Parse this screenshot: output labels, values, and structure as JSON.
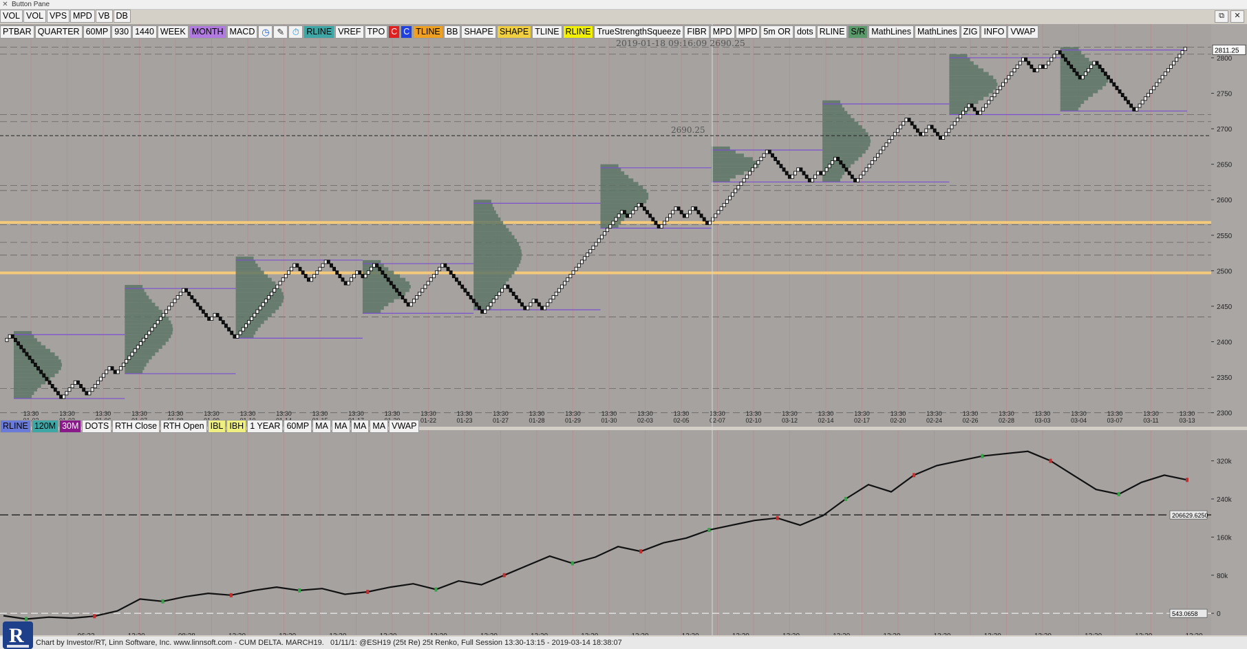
{
  "window": {
    "title": "Button Pane"
  },
  "toolbar1": [
    {
      "label": "VOL"
    },
    {
      "label": "VOL"
    },
    {
      "label": "VPS"
    },
    {
      "label": "MPD"
    },
    {
      "label": "VB"
    },
    {
      "label": "DB"
    }
  ],
  "toolbar2": [
    {
      "label": "PTBAR"
    },
    {
      "label": "QUARTER"
    },
    {
      "label": "60MP"
    },
    {
      "label": "930"
    },
    {
      "label": "1440"
    },
    {
      "label": "WEEK"
    },
    {
      "label": "MONTH",
      "bg": "#b07ae0"
    },
    {
      "label": "MACD"
    },
    {
      "icon": "clock-icon",
      "glyph": "◷",
      "fg": "#1a5fd0"
    },
    {
      "icon": "pencil-icon",
      "glyph": "✎",
      "fg": "#333"
    },
    {
      "icon": "stopwatch-icon",
      "glyph": "⏱",
      "fg": "#1a8fd0"
    },
    {
      "label": "RLINE",
      "bg": "#3fa6a6"
    },
    {
      "label": "VREF"
    },
    {
      "label": "TPO"
    },
    {
      "label": "C",
      "bg": "#e02020",
      "fg": "#ffffff"
    },
    {
      "label": "C",
      "bg": "#2040e0",
      "fg": "#ffffff"
    },
    {
      "label": "TLINE",
      "bg": "#f0a020"
    },
    {
      "label": "BB"
    },
    {
      "label": "SHAPE"
    },
    {
      "label": "SHAPE",
      "bg": "#f0d040"
    },
    {
      "label": "TLINE"
    },
    {
      "label": "RLINE",
      "bg": "#f0f000"
    },
    {
      "label": "TrueStrengthSqueeze"
    },
    {
      "label": "FIBR"
    },
    {
      "label": "MPD"
    },
    {
      "label": "MPD"
    },
    {
      "label": "5m OR"
    },
    {
      "label": "dots"
    },
    {
      "label": "RLINE"
    },
    {
      "label": "S/R",
      "bg": "#5a9a6a"
    },
    {
      "label": "MathLines"
    },
    {
      "label": "MathLines"
    },
    {
      "label": "ZIG"
    },
    {
      "label": "INFO"
    },
    {
      "label": "VWAP"
    }
  ],
  "toolbar3": [
    {
      "label": "RLINE",
      "bg": "#6a7ad8"
    },
    {
      "label": "120M",
      "bg": "#3fa6a6"
    },
    {
      "label": "30M",
      "bg": "#8a1a8a",
      "fg": "#ffffff"
    },
    {
      "label": "DOTS"
    },
    {
      "label": "RTH Close"
    },
    {
      "label": "RTH Open"
    },
    {
      "label": "IBL",
      "bg": "#f0f080"
    },
    {
      "label": "IBH",
      "bg": "#f0f080"
    },
    {
      "label": "1 YEAR"
    },
    {
      "label": "60MP"
    },
    {
      "label": "MA"
    },
    {
      "label": "MA"
    },
    {
      "label": "MA"
    },
    {
      "label": "MA"
    },
    {
      "label": "VWAP"
    }
  ],
  "window_controls": [
    {
      "icon": "restore-icon",
      "glyph": "⧉"
    },
    {
      "icon": "close-icon",
      "glyph": "✕"
    }
  ],
  "colors": {
    "chart_bg": "#a5a2a0",
    "right_axis_bg": "#a9a6a4",
    "profile": "#5c7565",
    "gold": "#f5c97a",
    "purple": "#7a4fd0",
    "grid": "#c07c86",
    "crosshair": "#d8d8d8"
  },
  "chart_data": [
    {
      "type": "renko",
      "panel": "price",
      "ylim": [
        2290,
        2830
      ],
      "yticks": [
        2300,
        2350,
        2400,
        2450,
        2500,
        2550,
        2600,
        2650,
        2700,
        2750,
        2800
      ],
      "last_price_label": "2811.25",
      "crosshair_readout": "2019-01-18 09:16:09 2690.25",
      "crosshair_price_label": "2690.25",
      "path": [
        2400,
        2410,
        2365,
        2320,
        2345,
        2325,
        2365,
        2355,
        2390,
        2430,
        2475,
        2440,
        2430,
        2440,
        2405,
        2455,
        2495,
        2510,
        2485,
        2515,
        2480,
        2500,
        2490,
        2510,
        2450,
        2510,
        2480,
        2440,
        2480,
        2445,
        2460,
        2445,
        2510,
        2560,
        2585,
        2575,
        2595,
        2560,
        2590,
        2575,
        2590,
        2565,
        2600,
        2610,
        2645,
        2670,
        2630,
        2645,
        2625,
        2640,
        2635,
        2660,
        2630,
        2625,
        2675,
        2715,
        2690,
        2705,
        2685,
        2735,
        2720,
        2770,
        2785,
        2800,
        2780,
        2790,
        2785,
        2810,
        2770,
        2795,
        2765,
        2725,
        2755,
        2795,
        2811
      ],
      "gold_levels": [
        2497,
        2568
      ],
      "dashed_levels": [
        2300,
        2334,
        2435,
        2522,
        2540,
        2565,
        2613,
        2620,
        2710,
        2720,
        2805,
        2815
      ],
      "date_labels": [
        "01-02",
        "01-03",
        "01-06",
        "01-07",
        "01-08",
        "01-09",
        "01-10",
        "01-14",
        "01-15",
        "01-17",
        "01-20",
        "01-22",
        "01-23",
        "01-27",
        "01-28",
        "01-29",
        "01-30",
        "02-03",
        "02-05",
        "02-07",
        "02-10",
        "03-12",
        "02-14",
        "02-17",
        "02-20",
        "02-24",
        "02-26",
        "02-28",
        "03-03",
        "03-04",
        "03-07",
        "03-11",
        "03-13"
      ],
      "time_label": "13:30"
    },
    {
      "type": "line",
      "panel": "cumulative-delta",
      "ylim": [
        -20000,
        370000
      ],
      "yticks": [
        0,
        80000,
        160000,
        240000,
        320000
      ],
      "ytick_labels": [
        "0",
        "80k",
        "160k",
        "240k",
        "320k"
      ],
      "dashed_level": 206629.625,
      "dashed_level_label": "206629.6250",
      "zero_level_label": "543.0658",
      "path": [
        -5000,
        -12000,
        -8000,
        -10000,
        -6000,
        5000,
        30000,
        25000,
        35000,
        42000,
        38000,
        48000,
        55000,
        48000,
        52000,
        40000,
        45000,
        55000,
        62000,
        50000,
        68000,
        60000,
        80000,
        100000,
        120000,
        105000,
        118000,
        140000,
        130000,
        148000,
        158000,
        175000,
        185000,
        195000,
        200000,
        185000,
        205000,
        240000,
        270000,
        255000,
        290000,
        310000,
        320000,
        330000,
        335000,
        340000,
        320000,
        290000,
        260000,
        250000,
        275000,
        290000,
        280000
      ],
      "time_labels": [
        "06:33",
        "13:30",
        "08:28",
        "13:30",
        "13:30",
        "13:30",
        "13:30",
        "13:30",
        "13:30",
        "13:30",
        "13:30",
        "13:30",
        "13:30",
        "13:30",
        "13:30",
        "13:30",
        "13:30",
        "13:30",
        "13:30",
        "13:30",
        "13:30",
        "13:30",
        "13:30"
      ]
    }
  ],
  "footer": {
    "credit": "Chart by Investor/RT, Linn Software, Inc. www.linnsoft.com - CUM DELTA. MARCH19.",
    "info": "01/11/1: @ESH19 (25t Re) 25t Renko, Full Session 13:30-13:15 - 2019-03-14 18:38:07"
  }
}
